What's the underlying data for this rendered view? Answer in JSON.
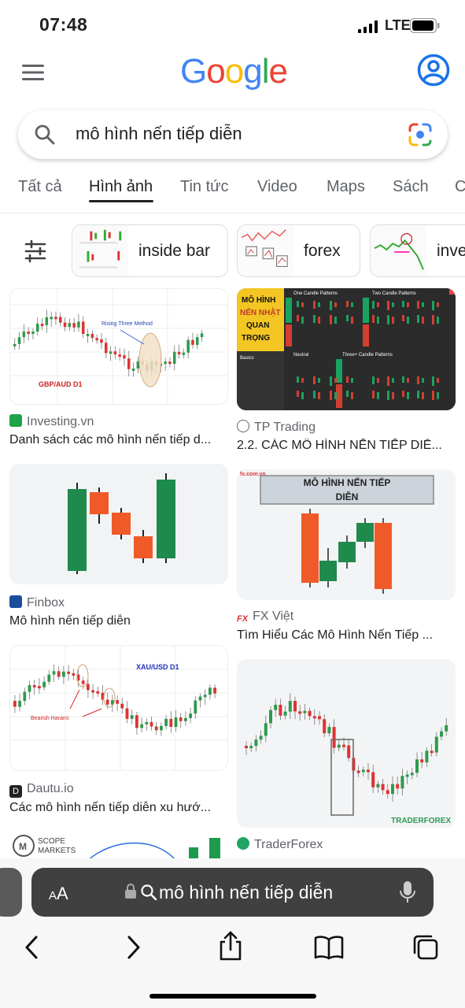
{
  "status": {
    "time": "07:48",
    "network": "LTE"
  },
  "header": {
    "logo_letters": [
      "G",
      "o",
      "o",
      "g",
      "l",
      "e"
    ],
    "logo_colors": [
      "#4285F4",
      "#EA4335",
      "#FBBC05",
      "#4285F4",
      "#34A853",
      "#EA4335"
    ]
  },
  "search": {
    "query": "mô hình nến tiếp diễn"
  },
  "tabs": [
    {
      "label": "Tất cả",
      "active": false
    },
    {
      "label": "Hình ảnh",
      "active": true
    },
    {
      "label": "Tin tức",
      "active": false
    },
    {
      "label": "Video",
      "active": false
    },
    {
      "label": "Maps",
      "active": false
    },
    {
      "label": "Sách",
      "active": false
    }
  ],
  "chips": [
    {
      "label": "inside bar"
    },
    {
      "label": "forex"
    },
    {
      "label": "inve"
    }
  ],
  "results": [
    {
      "source": "Investing.vn",
      "title": "Danh sách các mô hình nến tiếp d...",
      "image_text": [
        "Rising Three Method",
        "GBP/AUD D1"
      ]
    },
    {
      "source": "TP Trading",
      "title": "2.2. CÁC MÔ HÌNH NẾN TIẾP DIỄ...",
      "image_text": [
        "MÔ HÌNH",
        "NẾN NHẬT",
        "QUAN",
        "TRỌNG",
        "One Candle Patterns",
        "Two Candle Patterns",
        "Three+ Candle Patterns",
        "Neutral",
        "Basics",
        "Bullish",
        "Bearish"
      ]
    },
    {
      "source": "Finbox",
      "title": "Mô hình nến tiếp diễn",
      "image_text": []
    },
    {
      "source": "FX Việt",
      "title": "Tìm Hiểu Các Mô Hình Nến Tiếp ...",
      "image_text": [
        "MÔ HÌNH NẾN TIẾP",
        "DIỄN",
        "fx.com.vn"
      ]
    },
    {
      "source": "Dautu.io",
      "title": "Các mô hình nến tiếp diễn xu hướ...",
      "image_text": [
        "XAU/USD D1",
        "Bearish Harami"
      ]
    },
    {
      "source": "TraderForex",
      "title": "",
      "image_text": [
        "TRADERFOREX"
      ]
    },
    {
      "source": "",
      "title": "",
      "image_text": [
        "SCOPE",
        "MARKETS"
      ]
    }
  ],
  "safari": {
    "text_size_label": "AA",
    "url": "mô hình nến tiếp diễn"
  }
}
